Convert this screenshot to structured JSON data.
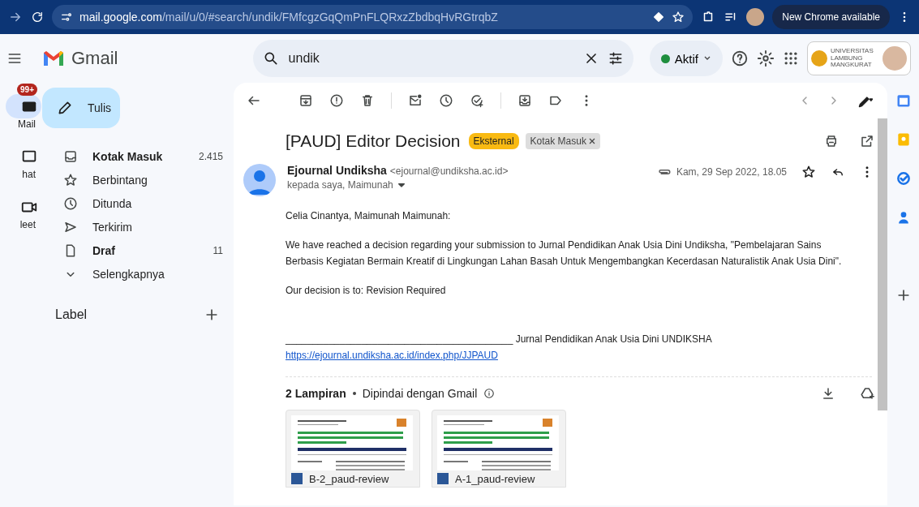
{
  "browser": {
    "url_host": "mail.google.com",
    "url_path": "/mail/u/0/#search/undik/FMfcgzGqQmPnFLQRxzZbdbqHvRGtrqbZ",
    "update_button": "New Chrome available"
  },
  "header": {
    "logo": "Gmail",
    "search": {
      "value": "undik"
    },
    "status": "Aktif",
    "org_logo": "UNIVERSITAS LAMBUNG MANGKURAT"
  },
  "rail": [
    {
      "label": "Mail",
      "badge": "99+",
      "selected": true,
      "kind": "mail"
    },
    {
      "label": "hat",
      "selected": false,
      "kind": "chat"
    },
    {
      "label": "leet",
      "selected": false,
      "kind": "meet"
    }
  ],
  "compose": "Tulis",
  "folders": [
    {
      "label": "Kotak Masuk",
      "count": "2.415",
      "unread": true,
      "kind": "inbox"
    },
    {
      "label": "Berbintang",
      "unread": false,
      "kind": "star"
    },
    {
      "label": "Ditunda",
      "unread": false,
      "kind": "clock"
    },
    {
      "label": "Terkirim",
      "unread": false,
      "kind": "send"
    },
    {
      "label": "Draf",
      "count": "11",
      "unread": true,
      "kind": "draft"
    },
    {
      "label": "Selengkapnya",
      "unread": false,
      "kind": "more"
    }
  ],
  "labels_heading": "Label",
  "message": {
    "subject": "[PAUD] Editor Decision",
    "tags": [
      {
        "label": "Eksternal",
        "kind": "external"
      },
      {
        "label": "Kotak Masuk",
        "kind": "folder"
      }
    ],
    "sender": "Ejournal Undiksha",
    "email": "<ejournal@undiksha.ac.id>",
    "recipients": "kepada saya, Maimunah",
    "date": "Kam, 29 Sep 2022, 18.05",
    "greeting": "Celia Cinantya, Maimunah Maimunah:",
    "paragraph": "We have reached a decision regarding your submission to Jurnal Pendidikan Anak Usia Dini Undiksha, \"Pembelajaran Sains Berbasis Kegiatan Bermain Kreatif di Lingkungan Lahan Basah Untuk Mengembangkan Kecerdasan Naturalistik Anak Usia Dini\".",
    "decision": "Our decision is to: Revision Required",
    "signature_rule": "__________________________________________",
    "signature": "Jurnal Pendidikan Anak Usia Dini UNDIKSHA",
    "link": "https://ejournal.undiksha.ac.id/index.php/JJPAUD"
  },
  "attachments": {
    "heading": "2 Lampiran",
    "note": "Dipindai dengan Gmail",
    "files": [
      {
        "name": "B-2_paud-review"
      },
      {
        "name": "A-1_paud-review"
      }
    ]
  }
}
